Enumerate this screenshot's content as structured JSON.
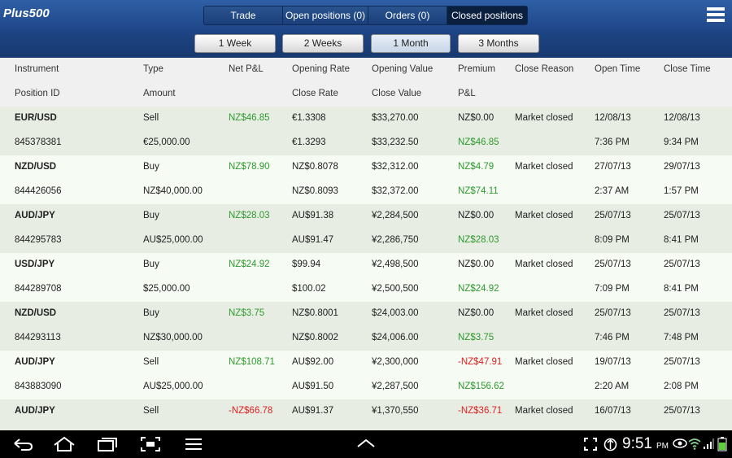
{
  "app": {
    "logo_text": "Plus500"
  },
  "tabs": [
    {
      "label": "Trade"
    },
    {
      "label": "Open positions (0)"
    },
    {
      "label": "Orders (0)"
    },
    {
      "label": "Closed positions",
      "active": true
    }
  ],
  "periods": [
    {
      "label": "1 Week"
    },
    {
      "label": "2 Weeks"
    },
    {
      "label": "1 Month",
      "active": true
    },
    {
      "label": "3 Months"
    }
  ],
  "table": {
    "headers_row1": [
      "Instrument",
      "Type",
      "Net P&L",
      "Opening Rate",
      "Opening Value",
      "Premium",
      "Close Reason",
      "Open Time",
      "Close Time"
    ],
    "headers_row2": [
      "Position ID",
      "Amount",
      "",
      "Close Rate",
      "Close Value",
      "P&L",
      "",
      "",
      ""
    ],
    "rows": [
      {
        "instrument": "EUR/USD",
        "type": "Sell",
        "net_pl": "NZ$46.85",
        "net_pl_color": "green",
        "opening_rate": "€1.3308",
        "opening_value": "$33,270.00",
        "premium": "NZ$0.00",
        "premium_color": "",
        "close_reason": "Market closed",
        "open_date": "12/08/13",
        "close_date": "12/08/13",
        "position_id": "845378381",
        "amount": "€25,000.00",
        "close_rate": "€1.3293",
        "close_value": "$33,232.50",
        "pl": "NZ$46.85",
        "pl_color": "green",
        "open_time": "7:36 PM",
        "close_time": "9:34 PM"
      },
      {
        "instrument": "NZD/USD",
        "type": "Buy",
        "net_pl": "NZ$78.90",
        "net_pl_color": "green",
        "opening_rate": "NZ$0.8078",
        "opening_value": "$32,312.00",
        "premium": "NZ$4.79",
        "premium_color": "green",
        "close_reason": "Market closed",
        "open_date": "27/07/13",
        "close_date": "29/07/13",
        "position_id": "844426056",
        "amount": "NZ$40,000.00",
        "close_rate": "NZ$0.8093",
        "close_value": "$32,372.00",
        "pl": "NZ$74.11",
        "pl_color": "green",
        "open_time": "2:37 AM",
        "close_time": "1:57 PM"
      },
      {
        "instrument": "AUD/JPY",
        "type": "Buy",
        "net_pl": "NZ$28.03",
        "net_pl_color": "green",
        "opening_rate": "AU$91.38",
        "opening_value": "¥2,284,500",
        "premium": "NZ$0.00",
        "premium_color": "",
        "close_reason": "Market closed",
        "open_date": "25/07/13",
        "close_date": "25/07/13",
        "position_id": "844295783",
        "amount": "AU$25,000.00",
        "close_rate": "AU$91.47",
        "close_value": "¥2,286,750",
        "pl": "NZ$28.03",
        "pl_color": "green",
        "open_time": "8:09 PM",
        "close_time": "8:41 PM"
      },
      {
        "instrument": "USD/JPY",
        "type": "Buy",
        "net_pl": "NZ$24.92",
        "net_pl_color": "green",
        "opening_rate": "$99.94",
        "opening_value": "¥2,498,500",
        "premium": "NZ$0.00",
        "premium_color": "",
        "close_reason": "Market closed",
        "open_date": "25/07/13",
        "close_date": "25/07/13",
        "position_id": "844289708",
        "amount": "$25,000.00",
        "close_rate": "$100.02",
        "close_value": "¥2,500,500",
        "pl": "NZ$24.92",
        "pl_color": "green",
        "open_time": "7:09 PM",
        "close_time": "8:41 PM"
      },
      {
        "instrument": "NZD/USD",
        "type": "Buy",
        "net_pl": "NZ$3.75",
        "net_pl_color": "green",
        "opening_rate": "NZ$0.8001",
        "opening_value": "$24,003.00",
        "premium": "NZ$0.00",
        "premium_color": "",
        "close_reason": "Market closed",
        "open_date": "25/07/13",
        "close_date": "25/07/13",
        "position_id": "844293113",
        "amount": "NZ$30,000.00",
        "close_rate": "NZ$0.8002",
        "close_value": "$24,006.00",
        "pl": "NZ$3.75",
        "pl_color": "green",
        "open_time": "7:46 PM",
        "close_time": "7:48 PM"
      },
      {
        "instrument": "AUD/JPY",
        "type": "Sell",
        "net_pl": "NZ$108.71",
        "net_pl_color": "green",
        "opening_rate": "AU$92.00",
        "opening_value": "¥2,300,000",
        "premium": "-NZ$47.91",
        "premium_color": "red",
        "close_reason": "Market closed",
        "open_date": "19/07/13",
        "close_date": "25/07/13",
        "position_id": "843883090",
        "amount": "AU$25,000.00",
        "close_rate": "AU$91.50",
        "close_value": "¥2,287,500",
        "pl": "NZ$156.62",
        "pl_color": "green",
        "open_time": "2:20 AM",
        "close_time": "2:08 PM"
      },
      {
        "instrument": "AUD/JPY",
        "type": "Sell",
        "net_pl": "-NZ$66.78",
        "net_pl_color": "red",
        "opening_rate": "AU$91.37",
        "opening_value": "¥1,370,550",
        "premium": "-NZ$36.71",
        "premium_color": "red",
        "close_reason": "Market closed",
        "open_date": "16/07/13",
        "close_date": "25/07/13",
        "position_id": "",
        "amount": "",
        "close_rate": "",
        "close_value": "",
        "pl": "",
        "pl_color": "",
        "open_time": "",
        "close_time": ""
      }
    ]
  },
  "statusbar": {
    "time": "9:51",
    "ampm": "PM"
  },
  "colors": {
    "green": "#2e9a2e",
    "red": "#dd2222",
    "header_blue": "#2a5599"
  }
}
